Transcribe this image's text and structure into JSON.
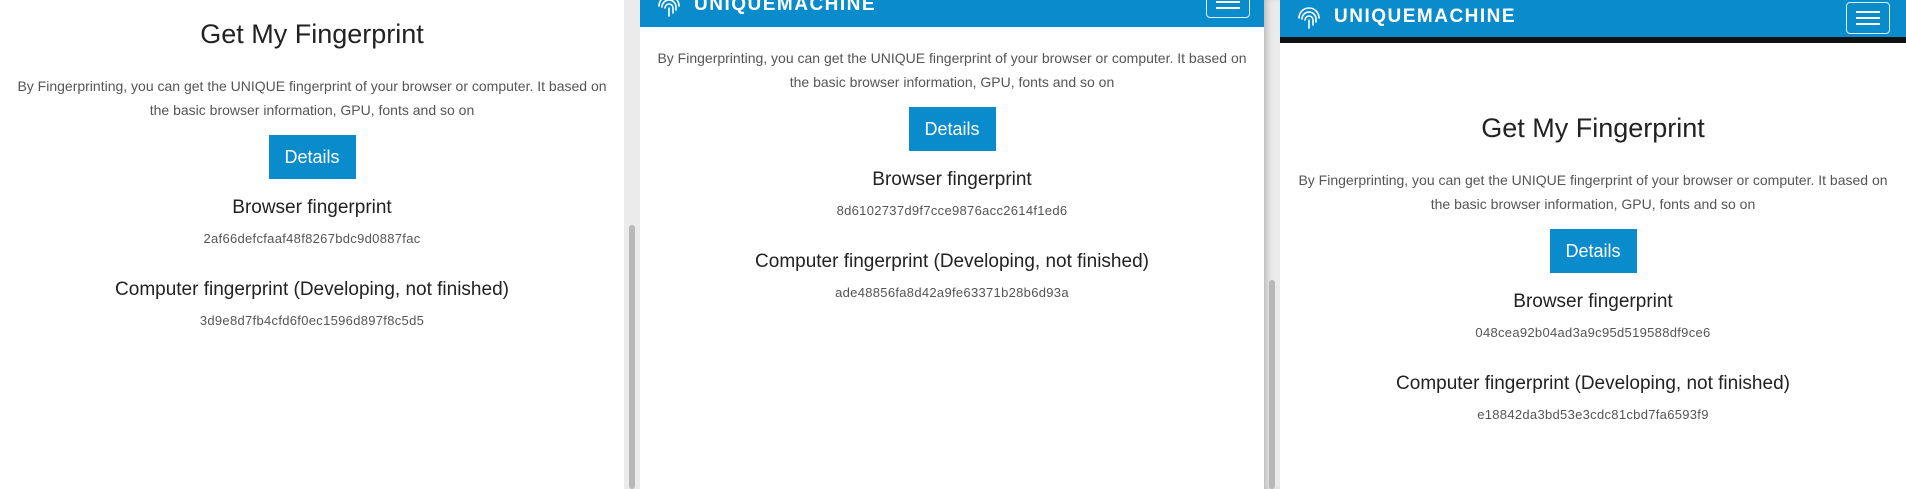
{
  "brand": {
    "name": "UNIQUEMACHINE",
    "accent": "#0a8ccc"
  },
  "page": {
    "title": "Get My Fingerprint",
    "description": "By Fingerprinting, you can get the UNIQUE fingerprint of your browser or computer. It based on the basic browser information, GPU, fonts and so on",
    "details_label": "Details",
    "browser_label": "Browser fingerprint",
    "computer_label": "Computer fingerprint (Developing, not finished)"
  },
  "panels": [
    {
      "browser_hash": "2af66defcfaaf48f8267bdc9d0887fac",
      "computer_hash": "3d9e8d7fb4cfd6f0ec1596d897f8c5d5"
    },
    {
      "browser_hash": "8d6102737d9f7cce9876acc2614f1ed6",
      "computer_hash": "ade48856fa8d42a9fe63371b28b6d93a"
    },
    {
      "browser_hash": "048cea92b04ad3a9c95d519588df9ce6",
      "computer_hash": "e18842da3bd53e3cdc81cbd7fa6593f9"
    }
  ]
}
